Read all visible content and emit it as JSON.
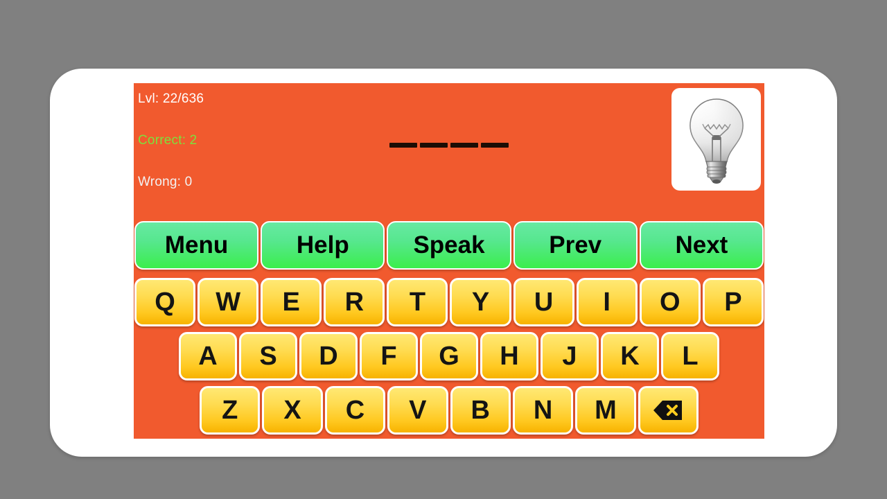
{
  "app": {
    "screen_background": "#f15a2e",
    "page_background": "#808080",
    "device": "phone-landscape"
  },
  "stats": {
    "level_label": "Lvl: 22/636",
    "level_current": 22,
    "level_total": 636,
    "correct_label": "Correct: 2",
    "correct_count": 2,
    "correct_color": "#7ee03c",
    "wrong_label": "Wrong: 0",
    "wrong_count": 0,
    "wrong_color": "#f2f2f2"
  },
  "puzzle": {
    "blank_count": 4,
    "blanks": [
      "",
      "",
      "",
      ""
    ],
    "hint_icon": "lightbulb-icon"
  },
  "actions": {
    "buttons": [
      {
        "label": "Menu",
        "name": "menu-button"
      },
      {
        "label": "Help",
        "name": "help-button"
      },
      {
        "label": "Speak",
        "name": "speak-button"
      },
      {
        "label": "Prev",
        "name": "prev-button"
      },
      {
        "label": "Next",
        "name": "next-button"
      }
    ],
    "color": "#3bee4c"
  },
  "keyboard": {
    "key_color": "#ffdc52",
    "row1": [
      "Q",
      "W",
      "E",
      "R",
      "T",
      "Y",
      "U",
      "I",
      "O",
      "P"
    ],
    "row2": [
      "A",
      "S",
      "D",
      "F",
      "G",
      "H",
      "J",
      "K",
      "L"
    ],
    "row3": [
      "Z",
      "X",
      "C",
      "V",
      "B",
      "N",
      "M"
    ],
    "backspace": {
      "label": "",
      "icon": "backspace-icon"
    }
  }
}
